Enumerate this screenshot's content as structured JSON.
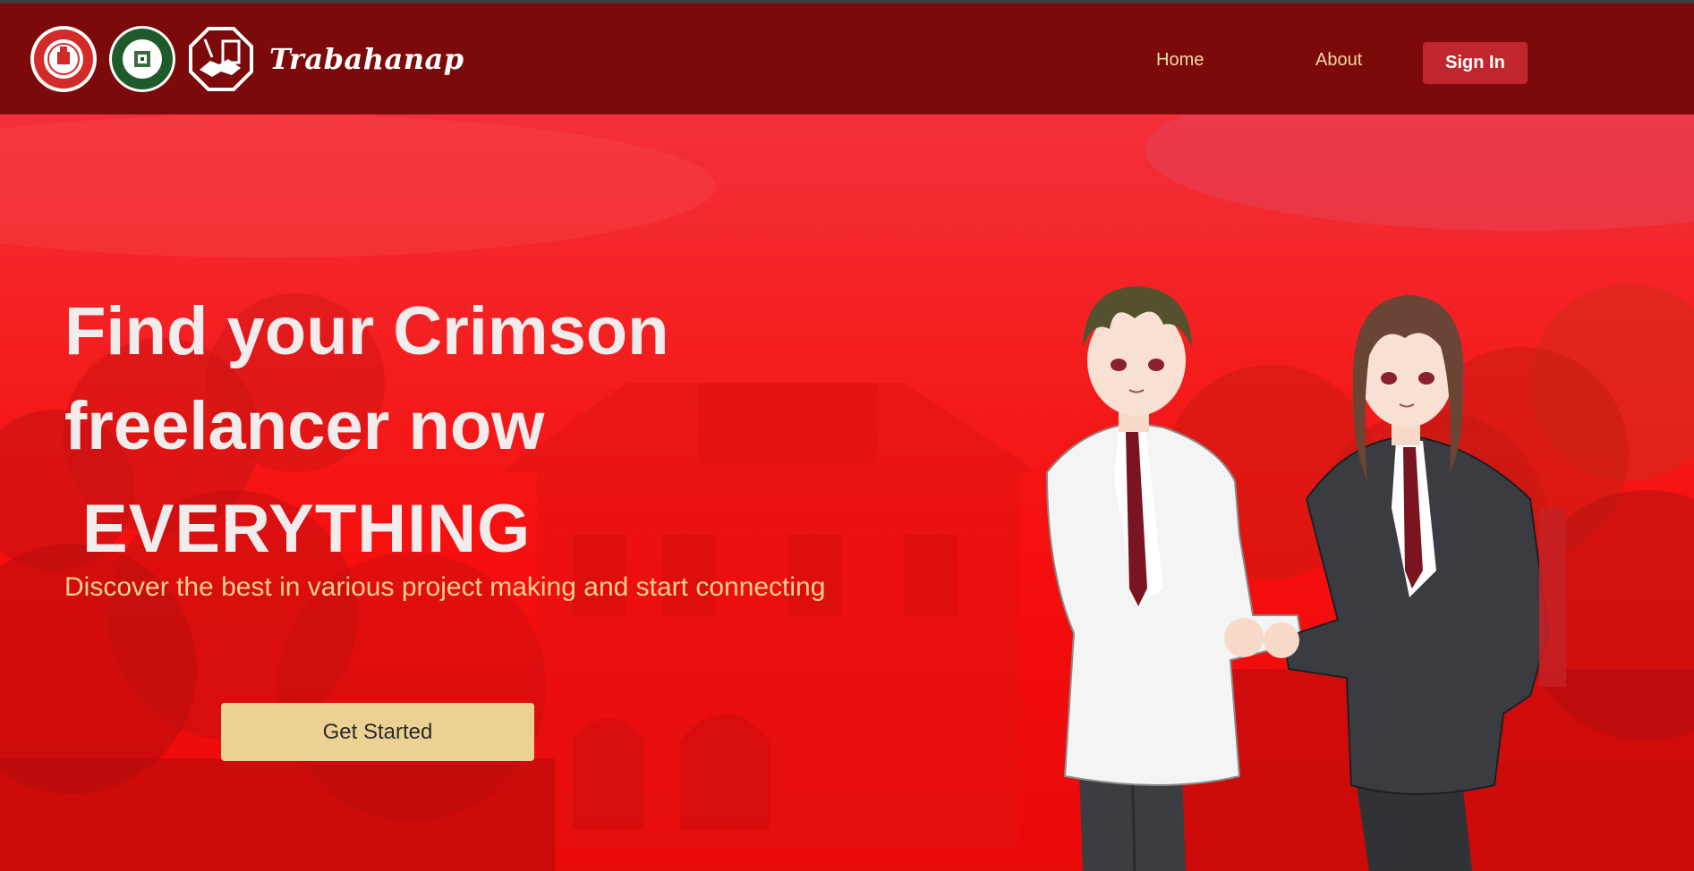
{
  "brand": {
    "name": "Trabahanap",
    "logos": [
      "university-seal",
      "college-of-computing-seal",
      "handshake-logo"
    ]
  },
  "nav": {
    "home_label": "Home",
    "about_label": "About",
    "signin_label": "Sign In"
  },
  "hero": {
    "headline": "Find your Crimson freelancer now",
    "highlight": "EVERYTHING",
    "tagline": "Discover the best in various project making and start connecting",
    "cta_label": "Get Started",
    "illustration": "two-students-handshake"
  },
  "colors": {
    "navbar": "#7c0a0a",
    "hero_red": "#f41c1c",
    "signin_button": "#c0262d",
    "cta_button": "#ecd292",
    "nav_link": "#f3d9a4",
    "tagline": "#f6cf8e"
  }
}
